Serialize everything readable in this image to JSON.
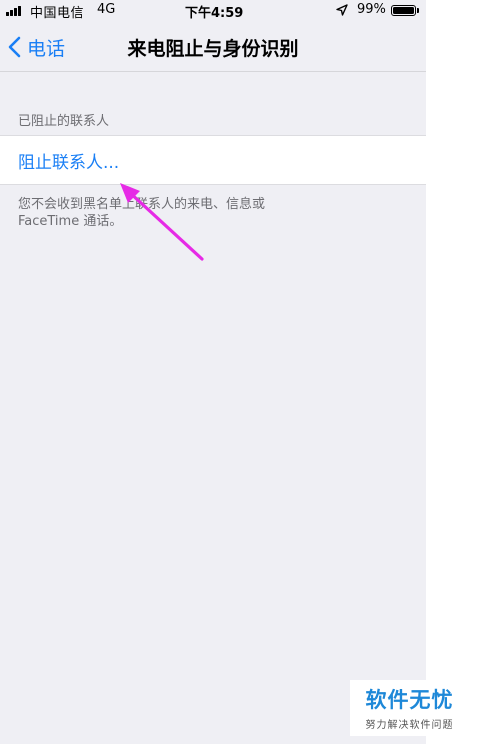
{
  "status_bar": {
    "carrier": "中国电信",
    "network": "4G",
    "time": "下午4:59",
    "battery_percent": "99%",
    "battery_level": 0.99
  },
  "nav": {
    "back_label": "电话",
    "title": "来电阻止与身份识别"
  },
  "section": {
    "header": "已阻止的联系人",
    "cell_label": "阻止联系人...",
    "footer": "您不会收到黑名单上联系人的来电、信息或 FaceTime 通话。"
  },
  "annotation": {
    "arrow_color": "#e62ae6"
  },
  "watermark": {
    "title": "软件无忧",
    "subtitle": "努力解决软件问题"
  },
  "colors": {
    "accent": "#1a7ff5",
    "background": "#efeff4"
  }
}
